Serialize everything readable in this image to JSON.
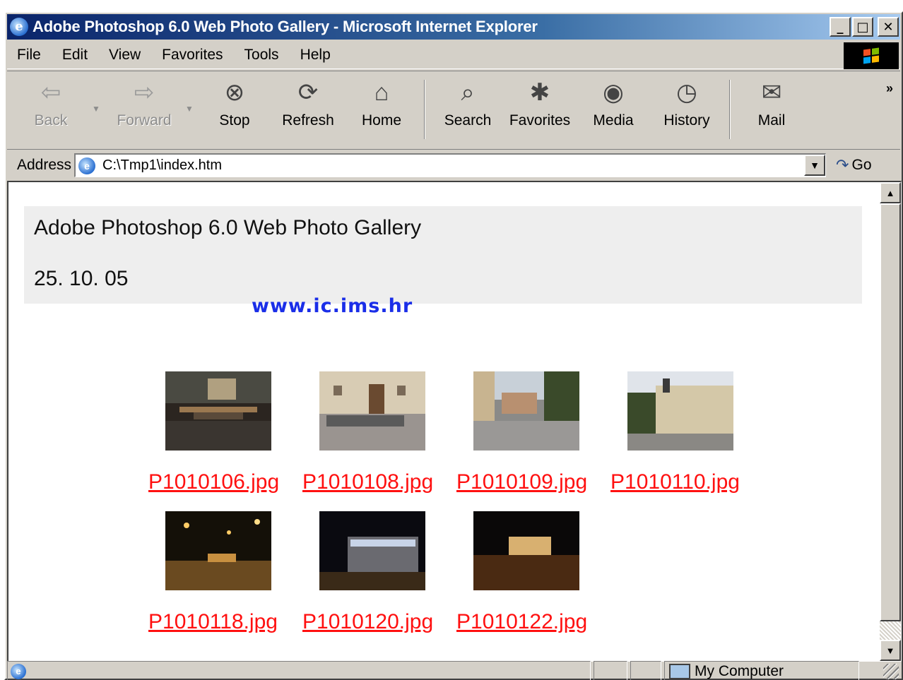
{
  "window": {
    "title": "Adobe Photoshop 6.0 Web Photo Gallery - Microsoft Internet Explorer",
    "controls": {
      "minimize": "_",
      "maximize": "□",
      "close": "✕"
    }
  },
  "menu": [
    "File",
    "Edit",
    "View",
    "Favorites",
    "Tools",
    "Help"
  ],
  "toolbar": {
    "back": "Back",
    "forward": "Forward",
    "stop": "Stop",
    "refresh": "Refresh",
    "home": "Home",
    "search": "Search",
    "favorites": "Favorites",
    "media": "Media",
    "history": "History",
    "mail": "Mail",
    "more": "»"
  },
  "address": {
    "label": "Address",
    "url": "C:\\Tmp1\\index.htm",
    "go": "Go"
  },
  "page": {
    "title": "Adobe Photoshop 6.0 Web Photo Gallery",
    "date": "25. 10. 05",
    "watermark": "www.ic.ims.hr",
    "link_color": "#ff1010",
    "photos": [
      {
        "file": "P1010106.jpg"
      },
      {
        "file": "P1010108.jpg"
      },
      {
        "file": "P1010109.jpg"
      },
      {
        "file": "P1010110.jpg"
      },
      {
        "file": "P1010118.jpg"
      },
      {
        "file": "P1010120.jpg"
      },
      {
        "file": "P1010122.jpg"
      }
    ]
  },
  "status": {
    "zone": "My Computer"
  },
  "colors": {
    "titlebar_start": "#0a246a",
    "titlebar_end": "#a6caf0",
    "chrome": "#d4d0c8"
  }
}
